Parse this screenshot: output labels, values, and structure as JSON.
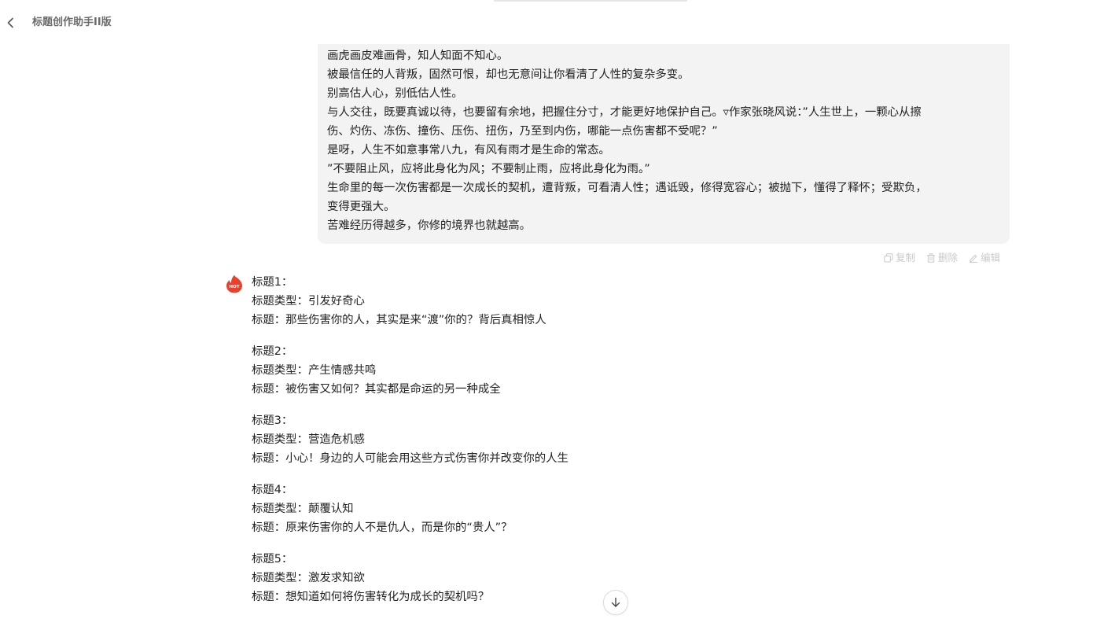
{
  "header": {
    "title": "标题创作助手II版"
  },
  "user_message": {
    "lines": [
      "画虎画皮难画骨，知人知面不知心。",
      "被最信任的人背叛，固然可恨，却也无意间让你看清了人性的复杂多变。",
      "别高估人心，别低估人性。",
      "与人交往，既要真诚以待，也要留有余地，把握住分寸，才能更好地保护自己。▿作家张晓风说：”人生世上，一颗心从擦",
      "伤、灼伤、冻伤、撞伤、压伤、扭伤，乃至到内伤，哪能一点伤害都不受呢？”",
      "是呀，人生不如意事常八九，有风有雨才是生命的常态。",
      "”不要阻止风，应将此身化为风；不要制止雨，应将此身化为雨。”",
      "生命里的每一次伤害都是一次成长的契机，遭背叛，可看清人性；遇诋毁，修得宽容心；被抛下，懂得了释怀；受欺负，",
      "变得更强大。",
      "苦难经历得越多，你修的境界也就越高。"
    ],
    "actions": {
      "copy": "复制",
      "delete": "删除",
      "edit": "编辑"
    }
  },
  "assistant": {
    "avatar_label": "HOT",
    "titles": [
      {
        "heading": "标题1：",
        "type_line": "标题类型：引发好奇心",
        "title_line": "标题：那些伤害你的人，其实是来“渡”你的？背后真相惊人"
      },
      {
        "heading": "标题2：",
        "type_line": "标题类型：产生情感共鸣",
        "title_line": "标题：被伤害又如何？其实都是命运的另一种成全"
      },
      {
        "heading": "标题3：",
        "type_line": "标题类型：营造危机感",
        "title_line": "标题：小心！身边的人可能会用这些方式伤害你并改变你的人生"
      },
      {
        "heading": "标题4：",
        "type_line": "标题类型：颠覆认知",
        "title_line": "标题：原来伤害你的人不是仇人，而是你的“贵人”？"
      },
      {
        "heading": "标题5：",
        "type_line": "标题类型：激发求知欲",
        "title_line": "标题：想知道如何将伤害转化为成长的契机吗？"
      }
    ]
  },
  "colors": {
    "bubble_bg": "#f3f3f3",
    "avatar_red": "#e8402a",
    "muted_text": "#c9c9c9"
  },
  "icons": {
    "back": "chevron-left-icon",
    "copy": "copy-icon",
    "delete": "trash-icon",
    "edit": "pencil-icon",
    "scroll": "arrow-down-icon"
  }
}
